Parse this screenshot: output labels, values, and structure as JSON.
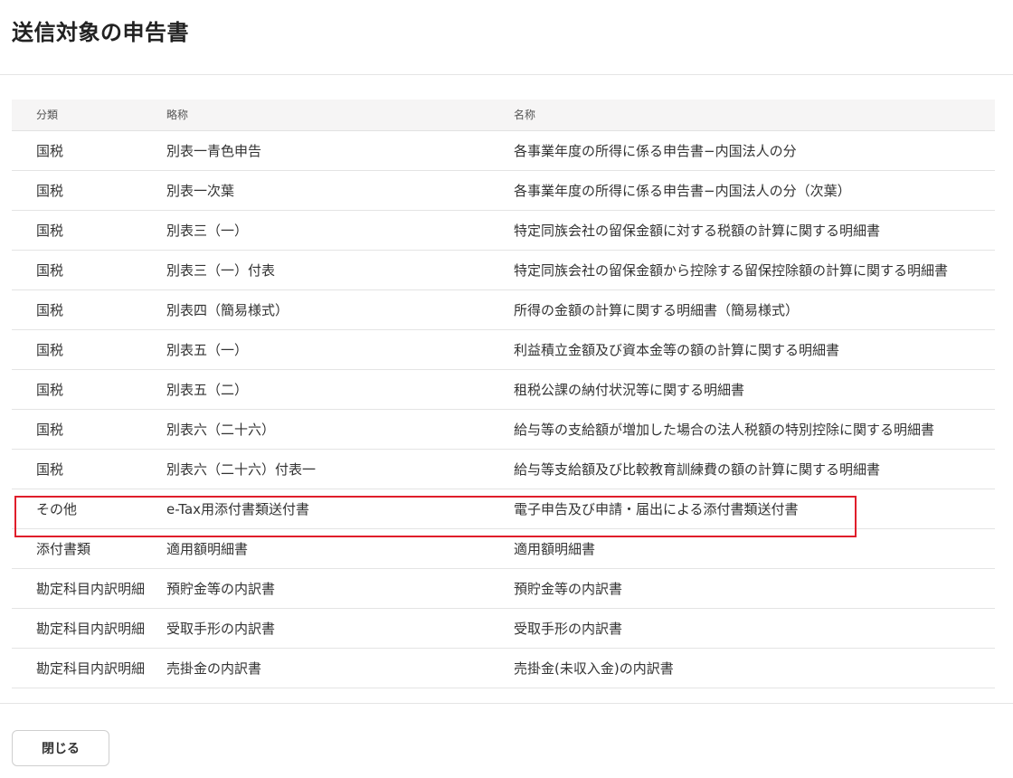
{
  "dialog": {
    "title": "送信対象の申告書"
  },
  "table": {
    "headers": [
      "分類",
      "略称",
      "名称"
    ],
    "rows": [
      [
        "国税",
        "別表一青色申告",
        "各事業年度の所得に係る申告書−内国法人の分"
      ],
      [
        "国税",
        "別表一次葉",
        "各事業年度の所得に係る申告書−内国法人の分（次葉）"
      ],
      [
        "国税",
        "別表三（一）",
        "特定同族会社の留保金額に対する税額の計算に関する明細書"
      ],
      [
        "国税",
        "別表三（一）付表",
        "特定同族会社の留保金額から控除する留保控除額の計算に関する明細書"
      ],
      [
        "国税",
        "別表四（簡易様式）",
        "所得の金額の計算に関する明細書（簡易様式）"
      ],
      [
        "国税",
        "別表五（一）",
        "利益積立金額及び資本金等の額の計算に関する明細書"
      ],
      [
        "国税",
        "別表五（二）",
        "租税公課の納付状況等に関する明細書"
      ],
      [
        "国税",
        "別表六（二十六）",
        "給与等の支給額が増加した場合の法人税額の特別控除に関する明細書"
      ],
      [
        "国税",
        "別表六（二十六）付表一",
        "給与等支給額及び比較教育訓練費の額の計算に関する明細書"
      ],
      [
        "その他",
        "e-Tax用添付書類送付書",
        "電子申告及び申請・届出による添付書類送付書"
      ],
      [
        "添付書類",
        "適用額明細書",
        "適用額明細書"
      ],
      [
        "勘定科目内訳明細",
        "預貯金等の内訳書",
        "預貯金等の内訳書"
      ],
      [
        "勘定科目内訳明細",
        "受取手形の内訳書",
        "受取手形の内訳書"
      ],
      [
        "勘定科目内訳明細",
        "売掛金の内訳書",
        "売掛金(未収入金)の内訳書"
      ]
    ],
    "highlighted_row": 9
  },
  "footer": {
    "close_label": "閉じる"
  },
  "colors": {
    "highlight_border": "#e01e2b",
    "header_background": "#f6f5f5"
  }
}
